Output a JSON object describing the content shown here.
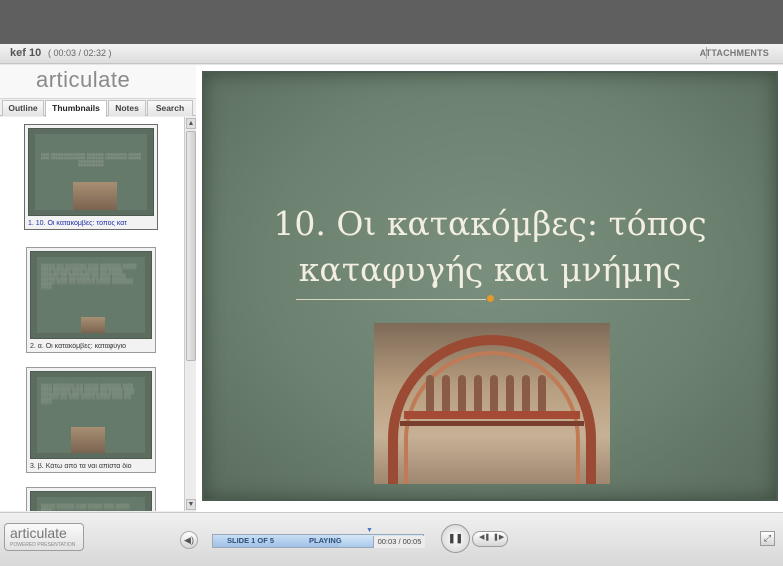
{
  "window": {
    "course_title": "kef 10",
    "course_time": "( 00:03 / 02:32 )",
    "attachments_label": "ATTACHMENTS"
  },
  "sidebar": {
    "logo": "articulate",
    "tabs": [
      {
        "label": "Outline"
      },
      {
        "label": "Thumbnails"
      },
      {
        "label": "Notes"
      },
      {
        "label": "Search"
      }
    ],
    "active_tab": "Thumbnails",
    "thumbnails": [
      {
        "caption": "1. 10. Οι κατακόμβες: τόπος κατ"
      },
      {
        "caption": "2. α. Οι κατακόμβες: καταφύγιο"
      },
      {
        "caption": "3. β. Κάτω από τα ναι απίστα δίο"
      }
    ]
  },
  "slide": {
    "title": "10. Οι κατακόμβες: τόπος καταφυγής και μνήμης",
    "accent_color": "#e39a2a"
  },
  "controls": {
    "logo_word": "articulate",
    "logo_sub": "POWERED PRESENTATION",
    "slide_counter": "SLIDE 1 OF 5",
    "status": "PLAYING",
    "time": "00:03 / 00:05",
    "progress_fraction": 0.6,
    "icons": {
      "volume": "volume-icon",
      "pause": "pause-icon",
      "prev": "prev-icon",
      "next": "next-icon",
      "fullscreen": "fullscreen-icon"
    }
  }
}
